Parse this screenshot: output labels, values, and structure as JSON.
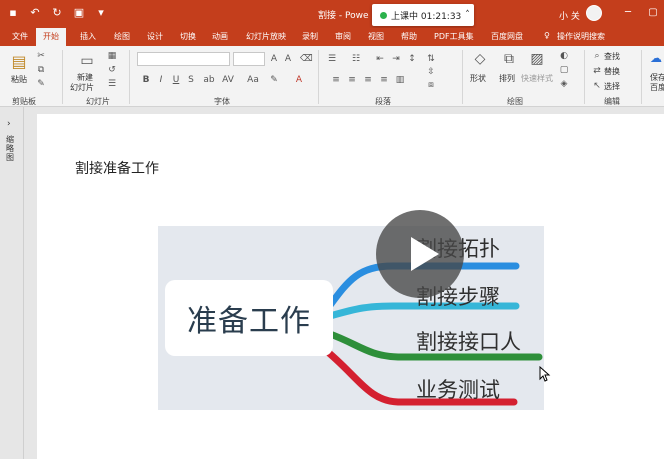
{
  "titlebar": {
    "doc_title": "割接 - Powe",
    "recording": "上课中 01:21:33",
    "user": "小 关",
    "colors": {
      "accent": "#c43e1c"
    }
  },
  "tabs": [
    "文件",
    "开始",
    "插入",
    "绘图",
    "设计",
    "切换",
    "动画",
    "幻灯片放映",
    "录制",
    "审阅",
    "视图",
    "帮助",
    "PDF工具集",
    "百度网盘",
    "操作说明搜索"
  ],
  "ribbon": {
    "groups": {
      "clipboard": "剪贴板",
      "slides": "幻灯片",
      "font": "字体",
      "paragraph": "段落",
      "drawing": "绘图",
      "editing": "编辑"
    },
    "paste": "粘贴",
    "new_slide": "新建",
    "new_slide2": "幻灯片",
    "shape": "形状",
    "arrange": "排列",
    "quick_style": "快速样式",
    "find": "查找",
    "replace": "替换",
    "select": "选择",
    "save": "保存",
    "baidu": "百度",
    "font_buttons": [
      "B",
      "I",
      "U",
      "S",
      "ab",
      "AV",
      "Aa",
      "A"
    ]
  },
  "sidebar": {
    "label": "缩略图"
  },
  "slide": {
    "title": "割接准备工作",
    "watermark": " ",
    "mindmap": {
      "central": "准备工作",
      "branches": [
        {
          "label": "割接拓扑",
          "color": "#2a8ee0"
        },
        {
          "label": "割接步骤",
          "color": "#36b6d8"
        },
        {
          "label": "割接接口人",
          "color": "#2e8f3a"
        },
        {
          "label": "业务测试",
          "color": "#d42030"
        }
      ]
    }
  }
}
